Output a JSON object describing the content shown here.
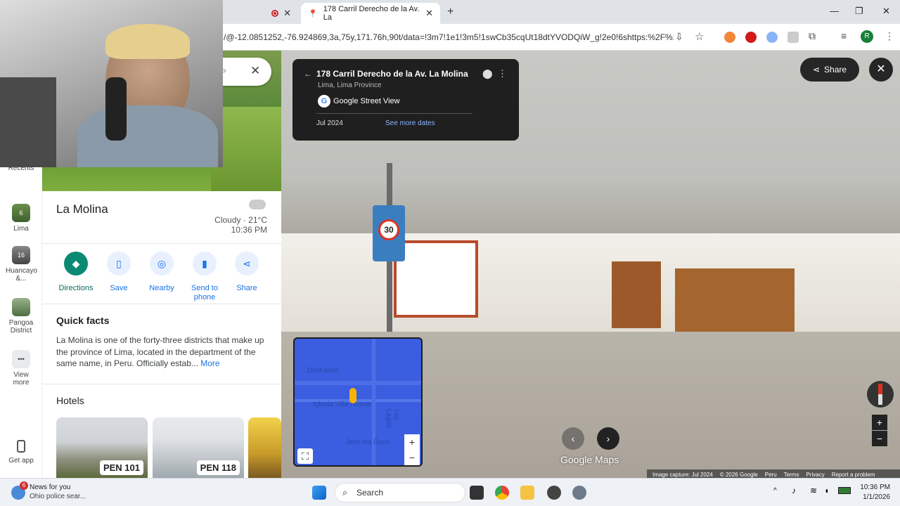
{
  "browser": {
    "tabs": [
      {
        "label": "",
        "active": false
      },
      {
        "label": "178 Carril Derecho de la Av. La",
        "active": true
      }
    ],
    "new_tab": "+",
    "url": "/@-12.0851252,-76.924869,3a,75y,171.76h,90t/data=!3m7!1e1!3m5!1swCb35cqUt18dtYVODQiW_g!2e0!6shttps:%2F%2Fst...",
    "profile_initial": "R"
  },
  "rail": {
    "recents_label": "Recents",
    "items": [
      {
        "label": "Lima",
        "badge": "6"
      },
      {
        "label": "Huancayo &...",
        "badge": "16"
      },
      {
        "label": "Pangoa District",
        "badge": ""
      }
    ],
    "view_more": "View more",
    "get_app": "Get app"
  },
  "panel": {
    "title": "La Molina",
    "weather": {
      "condition": "Cloudy · 21°C",
      "time": "10:36 PM"
    },
    "actions": [
      {
        "label": "Directions"
      },
      {
        "label": "Save"
      },
      {
        "label": "Nearby"
      },
      {
        "label": "Send to phone"
      },
      {
        "label": "Share"
      }
    ],
    "quick_facts": {
      "title": "Quick facts",
      "text": "La Molina is one of the forty-three districts that make up the province of Lima, located in the department of the same name, in Peru. Officially estab...",
      "more": "More"
    },
    "hotels": {
      "title": "Hotels",
      "items": [
        {
          "price": "PEN 101"
        },
        {
          "price": "PEN 118"
        }
      ]
    }
  },
  "streetview": {
    "card": {
      "title": "178 Carril Derecho de la Av. La Molina",
      "subtitle": "Lima, Lima Province",
      "source": "Google Street View",
      "date": "Jul 2024",
      "more_dates": "See more dates"
    },
    "share": "Share",
    "sign_speed": "30",
    "watermark": "Google Maps",
    "minimap_labels": [
      "Delifrance",
      "Iglesia Villa Nueva",
      "Jirón los Osos",
      "Los Lagos"
    ],
    "footer": [
      "Image capture: Jul 2024",
      "© 2026 Google",
      "Peru",
      "Terms",
      "Privacy",
      "Report a problem"
    ]
  },
  "taskbar": {
    "news_title": "News for you",
    "news_sub": "Ohio police sear...",
    "news_badge": "6",
    "search": "Search",
    "time": "10:36 PM",
    "date": "1/1/2026"
  }
}
